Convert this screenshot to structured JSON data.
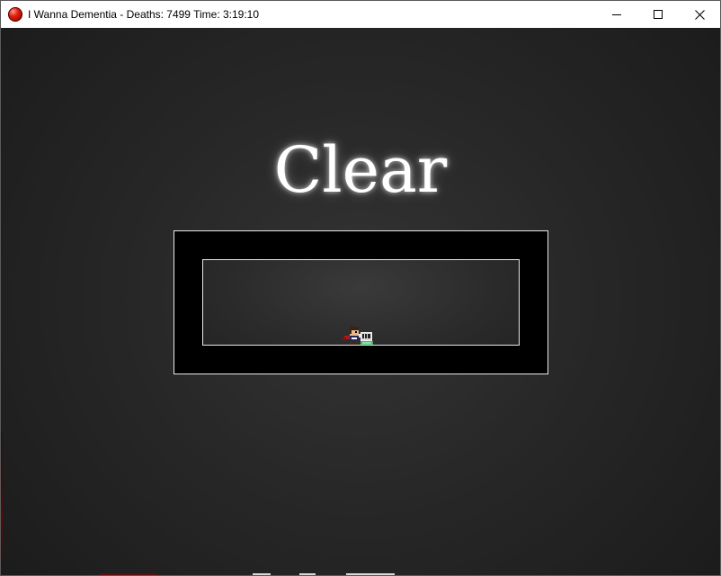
{
  "window": {
    "title": "I Wanna Dementia - Deaths: 7499 Time: 3:19:10",
    "icon": "red-orb-icon",
    "controls": {
      "minimize": "minimize-icon",
      "maximize": "maximize-icon",
      "close": "close-icon"
    }
  },
  "game": {
    "heading": "Clear",
    "player_sprite": "kid-character-icon",
    "colors": {
      "background": "#1c1c1c",
      "frame_fill": "#000000",
      "frame_border": "#e8e8e8",
      "heading": "#ffffff"
    }
  }
}
